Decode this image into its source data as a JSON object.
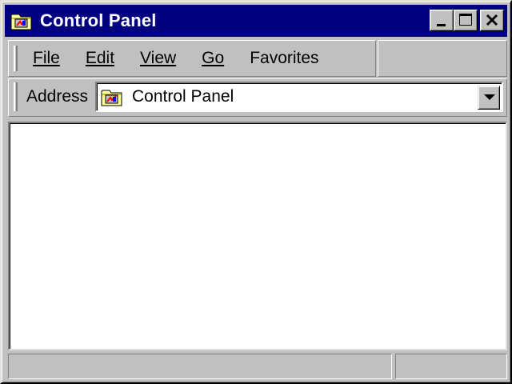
{
  "window": {
    "title": "Control Panel",
    "title_icon": "control-panel-folder-icon",
    "buttons": [
      "minimize-icon",
      "maximize-icon",
      "close-icon"
    ]
  },
  "menu": {
    "items": [
      {
        "label": "File"
      },
      {
        "label": "Edit"
      },
      {
        "label": "View"
      },
      {
        "label": "Go"
      },
      {
        "label": "Favorites"
      }
    ]
  },
  "address": {
    "label": "Address",
    "value": "Control Panel",
    "icon": "control-panel-folder-icon"
  },
  "status": {
    "left": "",
    "right": ""
  },
  "colors": {
    "titlebar": "#000080",
    "face": "#c0c0c0",
    "content": "#ffffff"
  }
}
